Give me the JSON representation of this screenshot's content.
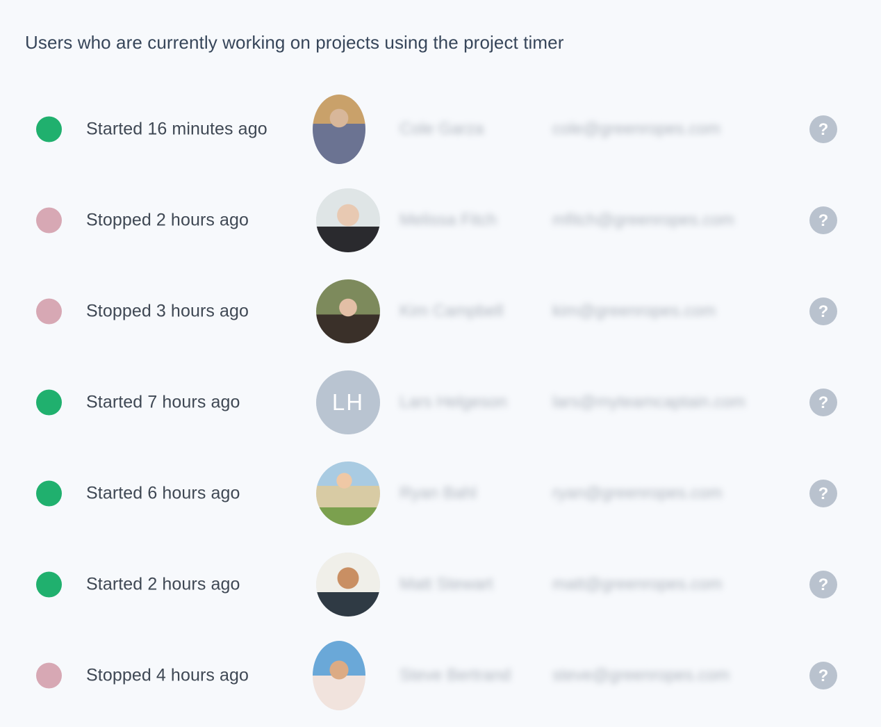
{
  "panel": {
    "title": "Users who are currently working on projects using the project timer"
  },
  "colors": {
    "background": "#f7f9fc",
    "title_text": "#37465a",
    "status_text": "#3f4854",
    "status_started": "#20b06e",
    "status_stopped": "#d7a8b4",
    "help_icon": "#b9c2ce",
    "initials_avatar": "#b9c4d1"
  },
  "icons": {
    "help": "question-mark-circle-icon"
  },
  "rows": [
    {
      "status": "started",
      "status_text": "Started 16 minutes ago",
      "name": "Cole Garza",
      "email": "cole@greenropes.com",
      "avatar_type": "photo",
      "avatar_initials": "",
      "help_label": "?"
    },
    {
      "status": "stopped",
      "status_text": "Stopped 2 hours ago",
      "name": "Melissa Fitch",
      "email": "mfitch@greenropes.com",
      "avatar_type": "photo",
      "avatar_initials": "",
      "help_label": "?"
    },
    {
      "status": "stopped",
      "status_text": "Stopped 3 hours ago",
      "name": "Kim Campbell",
      "email": "kim@greenropes.com",
      "avatar_type": "photo",
      "avatar_initials": "",
      "help_label": "?"
    },
    {
      "status": "started",
      "status_text": "Started 7 hours ago",
      "name": "Lars Helgeson",
      "email": "lars@myteamcaptain.com",
      "avatar_type": "initials",
      "avatar_initials": "LH",
      "help_label": "?"
    },
    {
      "status": "started",
      "status_text": "Started 6 hours ago",
      "name": "Ryan Bahl",
      "email": "ryan@greenropes.com",
      "avatar_type": "photo",
      "avatar_initials": "",
      "help_label": "?"
    },
    {
      "status": "started",
      "status_text": "Started 2 hours ago",
      "name": "Matt Stewart",
      "email": "matt@greenropes.com",
      "avatar_type": "photo",
      "avatar_initials": "",
      "help_label": "?"
    },
    {
      "status": "stopped",
      "status_text": "Stopped 4 hours ago",
      "name": "Steve Bertrand",
      "email": "steve@greenropes.com",
      "avatar_type": "photo",
      "avatar_initials": "",
      "help_label": "?"
    }
  ]
}
